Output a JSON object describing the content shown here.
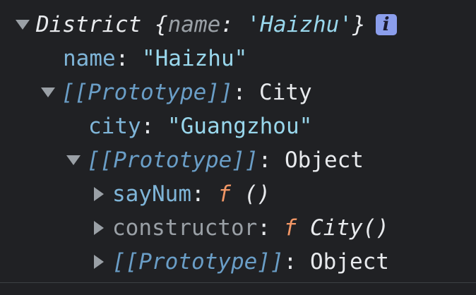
{
  "rows": {
    "district": {
      "class_name": "District",
      "open_brace": " {",
      "preview_key": "name",
      "colon": ": ",
      "preview_value": "'Haizhu'",
      "close_brace": "}",
      "info_icon": "info-icon"
    },
    "name": {
      "key": "name",
      "colon": ": ",
      "value": "\"Haizhu\""
    },
    "proto1": {
      "key": "[[Prototype]]",
      "colon": ": ",
      "value": "City"
    },
    "city": {
      "key": "city",
      "colon": ": ",
      "value": "\"Guangzhou\""
    },
    "proto2": {
      "key": "[[Prototype]]",
      "colon": ": ",
      "value": "Object"
    },
    "sayNum": {
      "key": "sayNum",
      "colon": ": ",
      "f": "f",
      "sig": " ()"
    },
    "constructor": {
      "key": "constructor",
      "colon": ": ",
      "f": "f",
      "sig": " City()"
    },
    "proto3": {
      "key": "[[Prototype]]",
      "colon": ": ",
      "value": "Object"
    }
  }
}
